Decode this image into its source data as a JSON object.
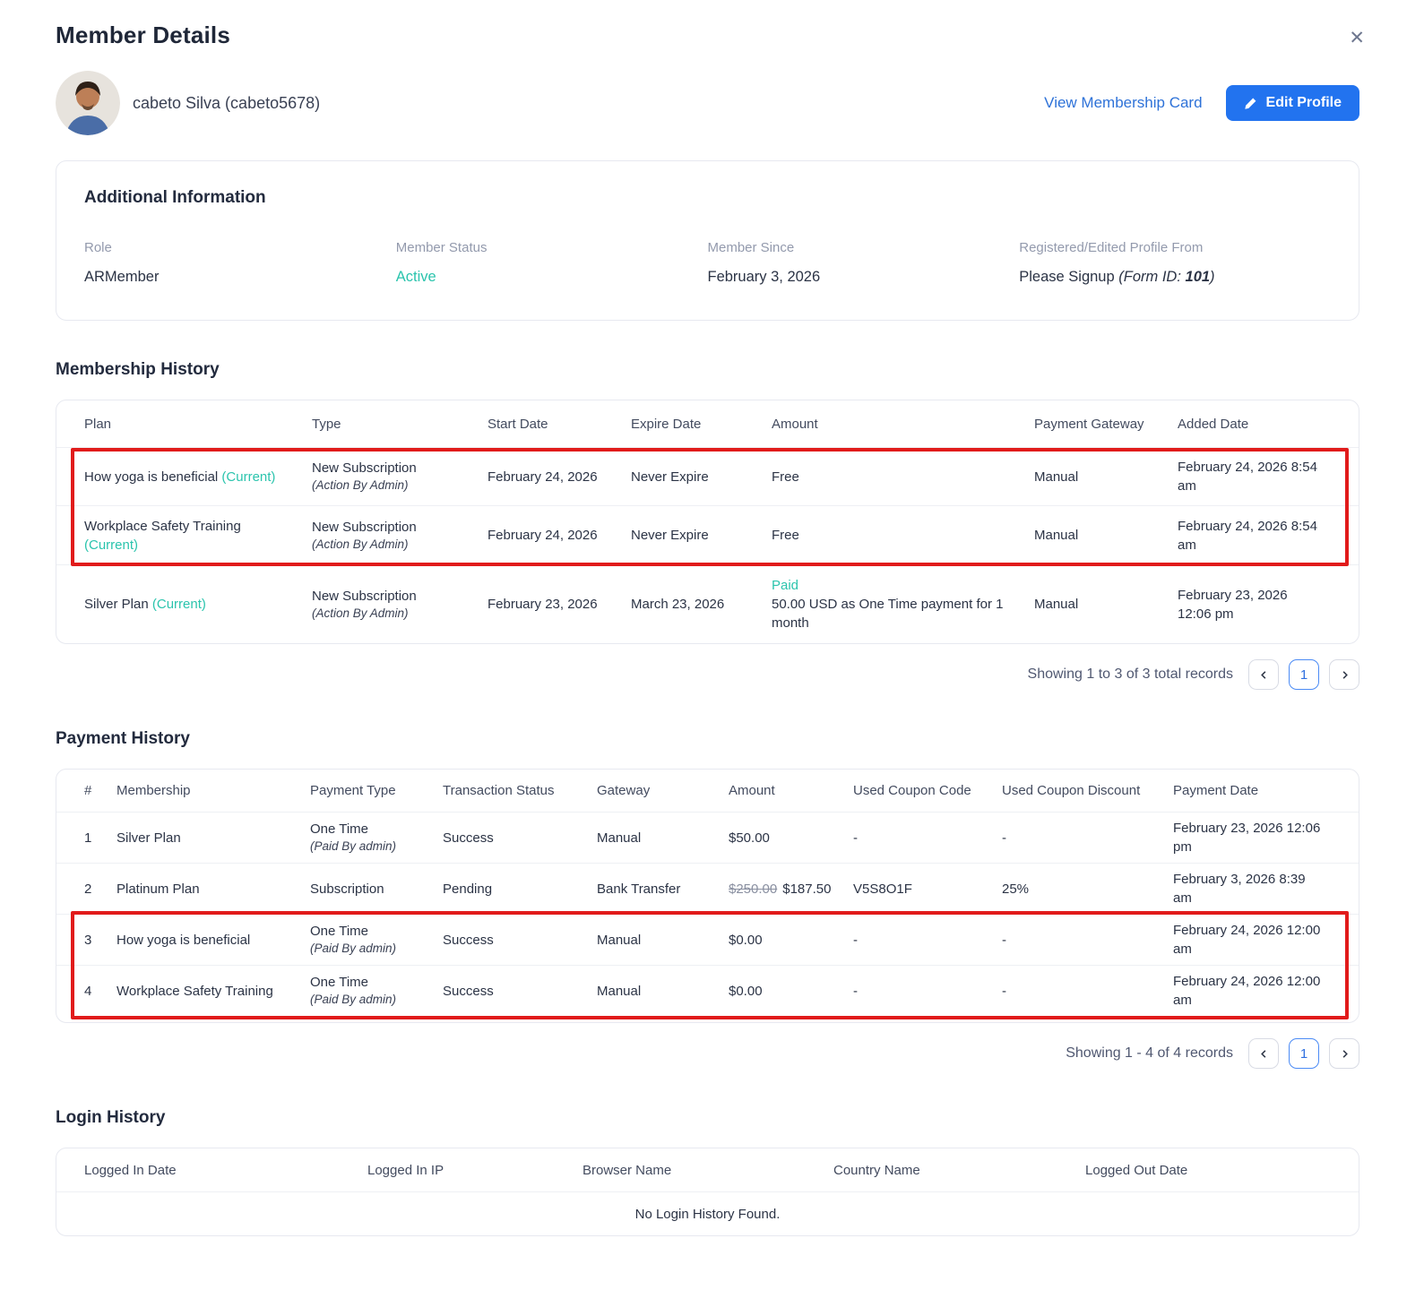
{
  "colors": {
    "accent_blue": "#2273ef",
    "link_blue": "#2e72d8",
    "teal_status": "#2bc4ad",
    "highlight_red": "#e11b1b"
  },
  "header": {
    "title": "Member Details",
    "close_icon": "✕"
  },
  "profile": {
    "name": "cabeto Silva (cabeto5678)",
    "view_membership_card_label": "View Membership Card",
    "edit_profile_label": "Edit Profile"
  },
  "additional_info": {
    "heading": "Additional Information",
    "role_label": "Role",
    "role_value": "ARMember",
    "status_label": "Member Status",
    "status_value": "Active",
    "since_label": "Member Since",
    "since_value": "February 3, 2026",
    "registered_label": "Registered/Edited Profile From",
    "registered_value": "Please Signup",
    "registered_form_prefix": "(Form ID: ",
    "registered_form_id": "101",
    "registered_form_suffix": ")"
  },
  "membership_history": {
    "heading": "Membership History",
    "columns": {
      "plan": "Plan",
      "type": "Type",
      "start": "Start Date",
      "expire": "Expire Date",
      "amount": "Amount",
      "gateway": "Payment Gateway",
      "added": "Added Date"
    },
    "rows": [
      {
        "plan": "How yoga is beneficial",
        "current": "(Current)",
        "type": "New Subscription",
        "type_sub": "(Action By Admin)",
        "start": "February 24, 2026",
        "expire": "Never Expire",
        "amount": "Free",
        "gateway": "Manual",
        "added": "February 24, 2026 8:54 am"
      },
      {
        "plan": "Workplace Safety Training",
        "current": "(Current)",
        "type": "New Subscription",
        "type_sub": "(Action By Admin)",
        "start": "February 24, 2026",
        "expire": "Never Expire",
        "amount": "Free",
        "gateway": "Manual",
        "added": "February 24, 2026 8:54 am"
      },
      {
        "plan": "Silver Plan",
        "current": "(Current)",
        "type": "New Subscription",
        "type_sub": "(Action By Admin)",
        "start": "February 23, 2026",
        "expire": "March 23, 2026",
        "amount_status": "Paid",
        "amount": "50.00 USD as One Time payment for 1 month",
        "gateway": "Manual",
        "added": "February 23, 2026 12:06 pm"
      }
    ],
    "footer_text": "Showing 1 to 3 of 3 total records",
    "page": "1"
  },
  "payment_history": {
    "heading": "Payment History",
    "columns": {
      "num": "#",
      "membership": "Membership",
      "ptype": "Payment Type",
      "status": "Transaction Status",
      "gateway": "Gateway",
      "amount": "Amount",
      "coupon": "Used Coupon Code",
      "discount": "Used Coupon Discount",
      "date": "Payment Date"
    },
    "rows": [
      {
        "num": "1",
        "membership": "Silver Plan",
        "ptype": "One Time",
        "ptype_sub": "(Paid By admin)",
        "status": "Success",
        "gateway": "Manual",
        "amount": "$50.00",
        "coupon": "-",
        "discount": "-",
        "date": "February 23, 2026 12:06 pm"
      },
      {
        "num": "2",
        "membership": "Platinum Plan",
        "ptype": "Subscription",
        "status": "Pending",
        "gateway": "Bank Transfer",
        "amount_original": "$250.00",
        "amount": "$187.50",
        "coupon": "V5S8O1F",
        "discount": "25%",
        "date": "February 3, 2026 8:39 am"
      },
      {
        "num": "3",
        "membership": "How yoga is beneficial",
        "ptype": "One Time",
        "ptype_sub": "(Paid By admin)",
        "status": "Success",
        "gateway": "Manual",
        "amount": "$0.00",
        "coupon": "-",
        "discount": "-",
        "date": "February 24, 2026 12:00 am"
      },
      {
        "num": "4",
        "membership": "Workplace Safety Training",
        "ptype": "One Time",
        "ptype_sub": "(Paid By admin)",
        "status": "Success",
        "gateway": "Manual",
        "amount": "$0.00",
        "coupon": "-",
        "discount": "-",
        "date": "February 24, 2026 12:00 am"
      }
    ],
    "footer_text": "Showing 1 - 4 of 4 records",
    "page": "1"
  },
  "login_history": {
    "heading": "Login History",
    "columns": {
      "in_date": "Logged In Date",
      "ip": "Logged In IP",
      "browser": "Browser Name",
      "country": "Country Name",
      "out_date": "Logged Out Date"
    },
    "empty_text": "No Login History Found."
  }
}
